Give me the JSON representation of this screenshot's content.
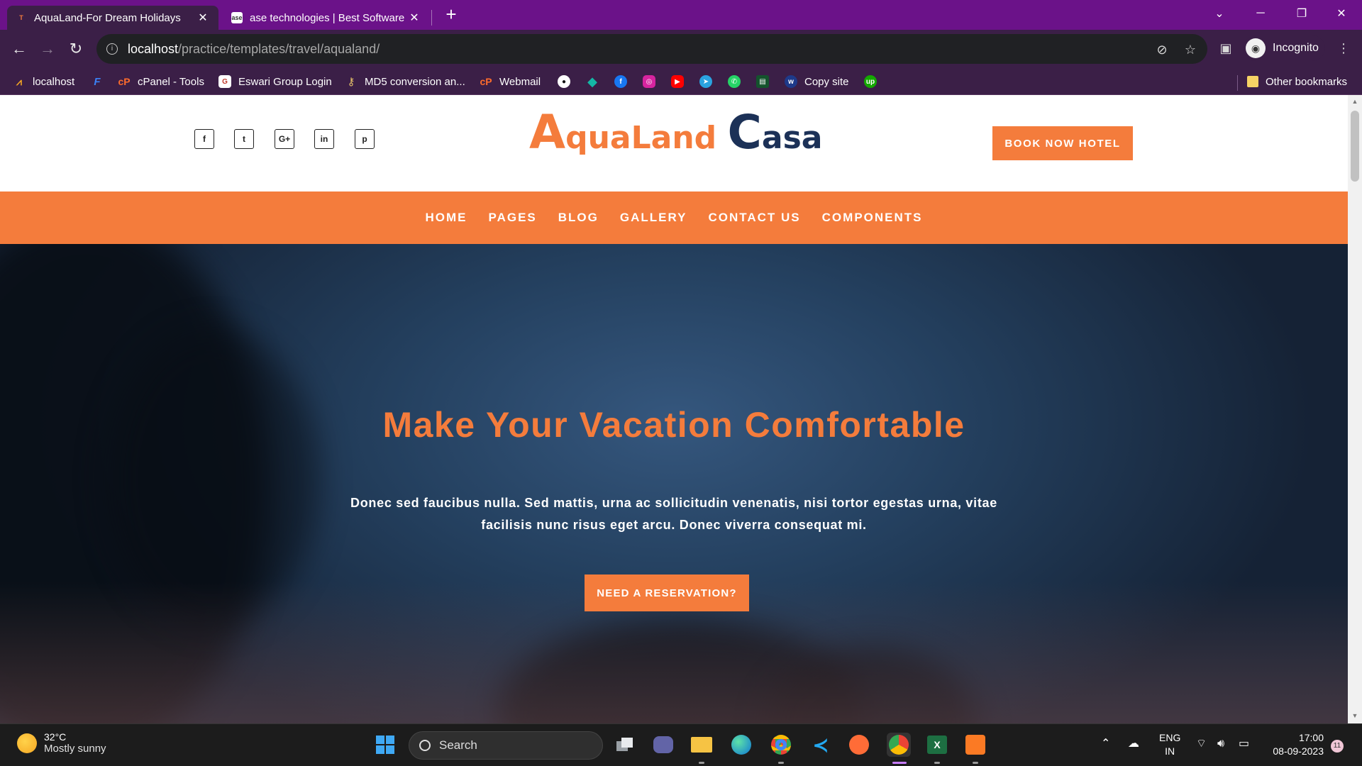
{
  "browser": {
    "tabs": [
      {
        "title": "AquaLand-For Dream Holidays",
        "active": true
      },
      {
        "title": "ase technologies | Best Software",
        "active": false
      }
    ],
    "url_host": "localhost",
    "url_path": "/practice/templates/travel/aqualand/",
    "profile_label": "Incognito",
    "bookmarks": [
      {
        "label": "localhost",
        "icon": "logo-icon",
        "color": "#f5a623"
      },
      {
        "label": "",
        "icon": "f-icon",
        "color": "#3b82f6"
      },
      {
        "label": "cPanel - Tools",
        "icon": "cpanel-icon",
        "color": "#ff6c2c"
      },
      {
        "label": "Eswari Group Login",
        "icon": "e-icon",
        "color": "#ffffff"
      },
      {
        "label": "MD5 conversion an...",
        "icon": "key-icon",
        "color": "#e9c46a"
      },
      {
        "label": "Webmail",
        "icon": "cpanel-icon",
        "color": "#ff6c2c"
      },
      {
        "label": "Copy site",
        "icon": "w-icon",
        "color": "#1e3a8a"
      }
    ],
    "other_bookmarks": "Other bookmarks"
  },
  "site": {
    "logo_part1_initial": "A",
    "logo_part1_rest": "quaLand",
    "logo_part2_initial": "C",
    "logo_part2_rest": "asa",
    "book_button": "BOOK NOW HOTEL",
    "social": [
      "f",
      "t",
      "G+",
      "in",
      "p"
    ],
    "menu": [
      "HOME",
      "PAGES",
      "BLOG",
      "GALLERY",
      "CONTACT US",
      "COMPONENTS"
    ],
    "hero_title": "Make Your Vacation Comfortable",
    "hero_text": "Donec sed faucibus nulla. Sed mattis, urna ac sollicitudin venenatis, nisi tortor egestas urna, vitae facilisis nunc risus eget arcu. Donec viverra consequat mi.",
    "hero_button": "NEED A RESERVATION?",
    "colors": {
      "accent": "#f47c3c",
      "navy": "#1c3157"
    }
  },
  "taskbar": {
    "weather_temp": "32°C",
    "weather_desc": "Mostly sunny",
    "search_label": "Search",
    "lang_line1": "ENG",
    "lang_line2": "IN",
    "time": "17:00",
    "date": "08-09-2023",
    "notification_count": "11"
  }
}
